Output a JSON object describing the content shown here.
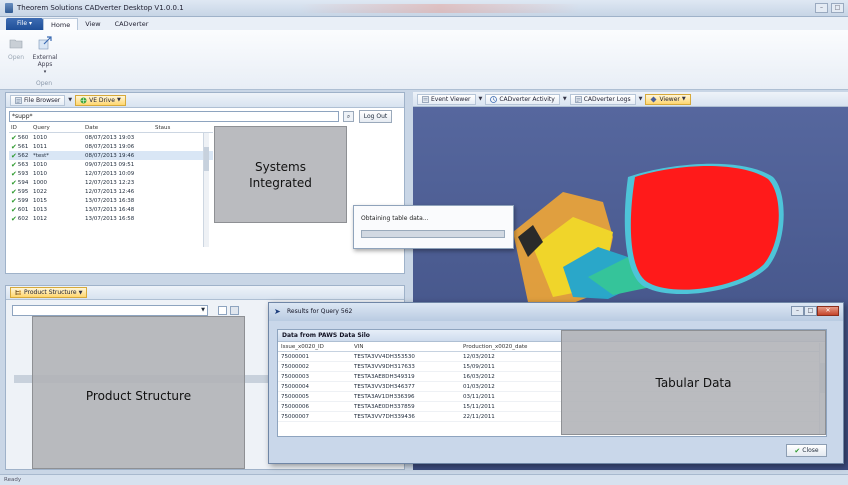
{
  "window": {
    "title": "Theorem Solutions CADverter Desktop V1.0.0.1"
  },
  "menu": {
    "file": "File",
    "tabs": [
      "Home",
      "View",
      "CADverter"
    ]
  },
  "ribbon": {
    "open": "Open",
    "external_apps": "External\nApps",
    "group_open": "Open"
  },
  "left_panel": {
    "tabs": {
      "file_browser": "File Browser",
      "ve_drive": "VE Drive"
    },
    "search_value": "*supp*",
    "logout": "Log Out",
    "columns": {
      "id": "ID",
      "query": "Query",
      "date": "Date",
      "status": "Staus"
    },
    "rows": [
      {
        "id": "560",
        "query": "1010",
        "date": "08/07/2013 19:03"
      },
      {
        "id": "561",
        "query": "1011",
        "date": "08/07/2013 19:06"
      },
      {
        "id": "562",
        "query": "*test*",
        "date": "08/07/2013 19:46"
      },
      {
        "id": "563",
        "query": "1010",
        "date": "09/07/2013 09:51"
      },
      {
        "id": "593",
        "query": "1010",
        "date": "12/07/2013 10:09"
      },
      {
        "id": "594",
        "query": "1000",
        "date": "12/07/2013 12:23"
      },
      {
        "id": "595",
        "query": "1022",
        "date": "12/07/2013 12:46"
      },
      {
        "id": "599",
        "query": "1015",
        "date": "13/07/2013 16:38"
      },
      {
        "id": "601",
        "query": "1013",
        "date": "13/07/2013 16:48"
      },
      {
        "id": "602",
        "query": "1012",
        "date": "13/07/2013 16:58"
      }
    ]
  },
  "overlays": {
    "systems": "Systems\nIntegrated",
    "product": "Product Structure",
    "tabular": "Tabular Data"
  },
  "right_panel": {
    "tabs": {
      "event_viewer": "Event Viewer",
      "activity": "CADverter Activity",
      "logs": "CADverter Logs",
      "viewer": "Viewer"
    }
  },
  "progress": {
    "label": "Obtaining table data..."
  },
  "product_panel": {
    "tab": "Product Structure"
  },
  "results": {
    "title": "Results for Query 562",
    "silo_header": "Data from PAWS Data Silo",
    "columns": {
      "issue": "Issue_x0020_ID",
      "vin": "VIN",
      "date": "Production_x0020_date"
    },
    "rows": [
      {
        "issue": "75000001",
        "vin": "TESTA3VV4DH353530",
        "date": "12/03/2012"
      },
      {
        "issue": "75000002",
        "vin": "TESTA3VV9DH317633",
        "date": "15/09/2011"
      },
      {
        "issue": "75000003",
        "vin": "TESTA3AE8DH349319",
        "date": "16/03/2012"
      },
      {
        "issue": "75000004",
        "vin": "TESTA3VV3DH346377",
        "date": "01/03/2012"
      },
      {
        "issue": "75000005",
        "vin": "TESTA3AV1DH336396",
        "date": "03/11/2011"
      },
      {
        "issue": "75000006",
        "vin": "TESTA3AE0DH337859",
        "date": "15/11/2011"
      },
      {
        "issue": "75000007",
        "vin": "TESTA3VV7DH339436",
        "date": "22/11/2011"
      }
    ],
    "close": "Close"
  },
  "status": "Ready",
  "colors": {
    "accent": "#2f5a94",
    "viewer_bg": "#4c5d93",
    "ok_green": "#2e9a2e",
    "highlight": "#ffd66e"
  }
}
